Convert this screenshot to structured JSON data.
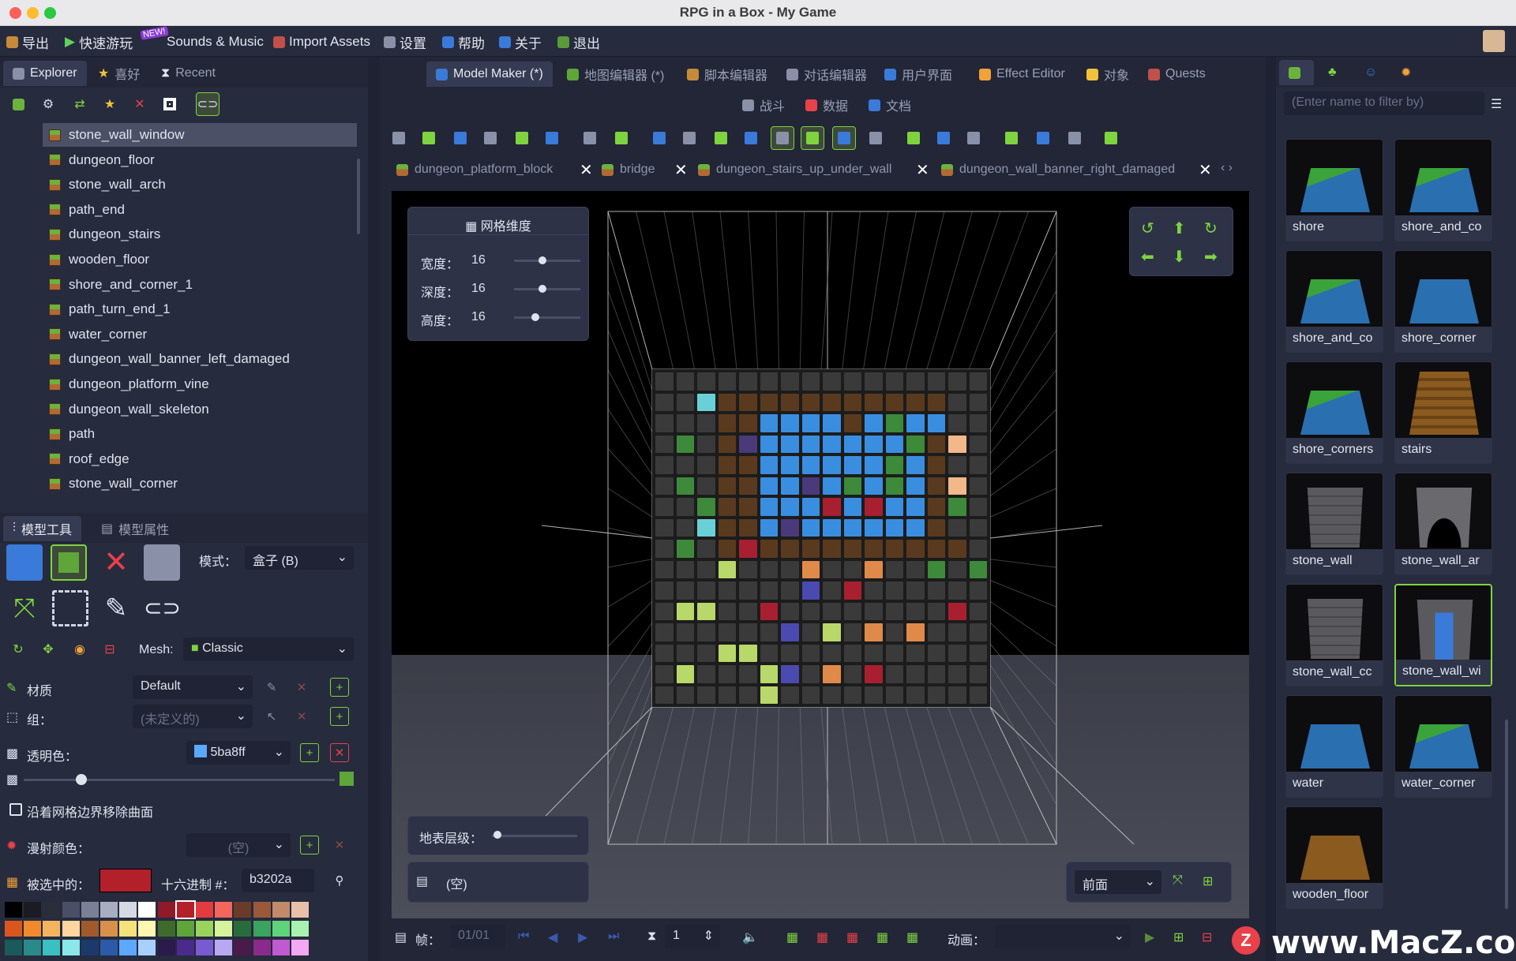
{
  "window": {
    "title": "RPG in a Box - My Game"
  },
  "menu": [
    {
      "label": "导出",
      "icon": "export-icon"
    },
    {
      "label": "快速游玩",
      "icon": "play-icon"
    },
    {
      "label": "Sounds & Music",
      "icon": "music-icon",
      "badge": "NEW!"
    },
    {
      "label": "Import Assets",
      "icon": "import-icon"
    },
    {
      "label": "设置",
      "icon": "wrench-icon"
    },
    {
      "label": "帮助",
      "icon": "help-icon"
    },
    {
      "label": "关于",
      "icon": "info-icon"
    },
    {
      "label": "退出",
      "icon": "exit-icon"
    }
  ],
  "left_tabs": [
    {
      "label": "Explorer"
    },
    {
      "label": "喜好"
    },
    {
      "label": "Recent"
    }
  ],
  "tree": [
    "stone_wall_window",
    "dungeon_floor",
    "stone_wall_arch",
    "path_end",
    "dungeon_stairs",
    "wooden_floor",
    "shore_and_corner_1",
    "path_turn_end_1",
    "water_corner",
    "dungeon_wall_banner_left_damaged",
    "dungeon_platform_vine",
    "dungeon_wall_skeleton",
    "path",
    "roof_edge",
    "stone_wall_corner"
  ],
  "editor_tabs": [
    {
      "label": "Model Maker (*)",
      "active": true
    },
    {
      "label": "地图编辑器 (*)"
    },
    {
      "label": "脚本编辑器"
    },
    {
      "label": "对话编辑器"
    },
    {
      "label": "用户界面"
    },
    {
      "label": "Effect Editor"
    },
    {
      "label": "对象"
    },
    {
      "label": "Quests"
    }
  ],
  "editor_tabs_row2": [
    {
      "label": "战斗"
    },
    {
      "label": "数据"
    },
    {
      "label": "文档"
    }
  ],
  "doc_tabs": [
    "dungeon_platform_block",
    "bridge",
    "dungeon_stairs_up_under_wall",
    "dungeon_wall_banner_right_damaged"
  ],
  "grid_panel": {
    "title": "网格维度",
    "rows": [
      {
        "label": "宽度：",
        "value": "16"
      },
      {
        "label": "深度：",
        "value": "16"
      },
      {
        "label": "高度：",
        "value": "16"
      }
    ]
  },
  "ground_level_label": "地表层级：",
  "frame_empty": "(空)",
  "view_select": "前面",
  "tool_tabs": [
    {
      "label": "模型工具"
    },
    {
      "label": "模型属性"
    }
  ],
  "tools": {
    "mode_label": "模式：",
    "mode_value": "盒子 (B)",
    "mesh_label": "Mesh:",
    "mesh_value": "Classic",
    "material_label": "材质",
    "material_value": "Default",
    "group_label": "组：",
    "group_value": "(未定义的)",
    "transparent_label": "透明色：",
    "transparent_value": "5ba8ff",
    "remove_label": "沿着网格边界移除曲面",
    "diffuse_label": "漫射颜色：",
    "diffuse_value": "(空)",
    "selected_label": "被选中的：",
    "hex_label": "十六进制 #：",
    "hex_value": "b3202a",
    "selected_color": "#b3202a"
  },
  "palette": [
    "#000000",
    "#1b1b24",
    "#2c2d3a",
    "#4b4f66",
    "#7c8097",
    "#a8adc1",
    "#d6d9e4",
    "#ffffff",
    "#8e1a2a",
    "#b3202a",
    "#e43b3f",
    "#f2665e",
    "#6b3b2a",
    "#9a5a3a",
    "#c18a6a",
    "#e8c0a8",
    "#d9571f",
    "#f08a2c",
    "#f4b45f",
    "#ffd6a0",
    "#a05a2c",
    "#d8904a",
    "#f6e27a",
    "#fff6b0",
    "#3e6b2a",
    "#5ea63a",
    "#9ad35c",
    "#d6f29a",
    "#2a6b3e",
    "#3aa35e",
    "#5fd37a",
    "#a8f2b0",
    "#1b5a5a",
    "#2a8a8a",
    "#3ac0c0",
    "#8ae8e8",
    "#1b3a6b",
    "#2a5aa8",
    "#5ba8ff",
    "#a8d0ff",
    "#2a1b4a",
    "#4a2a8a",
    "#7a5ad0",
    "#b8a8f2",
    "#4a1b4a",
    "#8a2a8a",
    "#c05ad0",
    "#f2a8f2"
  ],
  "status": {
    "frame_label": "帧：",
    "frame_value": "01/01",
    "count_value": "1",
    "anim_label": "动画："
  },
  "filter_placeholder": "(Enter name to filter by)",
  "thumbs": [
    {
      "name": "shore",
      "kind": "shore"
    },
    {
      "name": "shore_and_co",
      "kind": "shore"
    },
    {
      "name": "shore_and_co",
      "kind": "shore"
    },
    {
      "name": "shore_corner",
      "kind": "water"
    },
    {
      "name": "shore_corners",
      "kind": "shore"
    },
    {
      "name": "stairs",
      "kind": "stairs"
    },
    {
      "name": "stone_wall",
      "kind": "wall"
    },
    {
      "name": "stone_wall_ar",
      "kind": "arch"
    },
    {
      "name": "stone_wall_cc",
      "kind": "wall"
    },
    {
      "name": "stone_wall_wi",
      "kind": "window"
    },
    {
      "name": "water",
      "kind": "water"
    },
    {
      "name": "water_corner",
      "kind": "shore"
    },
    {
      "name": "wooden_floor",
      "kind": "wood"
    }
  ],
  "watermark": "www.MacZ.com",
  "watermark_badge": "Z",
  "voxel_colors": {
    "bg": "#3a3a3a",
    "brown": "#5a3a1e",
    "blue": "#3a8ee0",
    "green": "#3c8a3a",
    "cyan": "#6ad0d8",
    "purple": "#4a3a7a",
    "red": "#a82030",
    "peach": "#f2b88a",
    "lime": "#b8d86a",
    "orange": "#e08a4a",
    "indigo": "#4a4ab0",
    "dark": "#2d2d2d"
  },
  "voxel_rows": [
    "kkkkkkkkkkkkkkkk",
    "kkcbbbbbbbbbbbkk",
    "kkkbbBBBBbBgBBkk",
    "kgkbpBBBBBBBgbPk",
    "kkkbbBBBBBBgBbkk",
    "kgkbbBBpBgBgBbPk",
    "kkgbbBBBrBrBBbgk",
    "kkcbbBpBBBBBBbkk",
    "kgkbrbbbbbbbbbbk",
    "kkkLkkkOkkOkkgkg",
    "kkkkkkkIkrkkkkkk",
    "kLLkkrkkkkkkkkrk",
    "kkkkkkIkLkOkOkkk",
    "kkkLLkkkkkkkkkkk",
    "kLkkkLIkOkrkkkkk",
    "kkkkkLkkkkkkkkkk"
  ]
}
